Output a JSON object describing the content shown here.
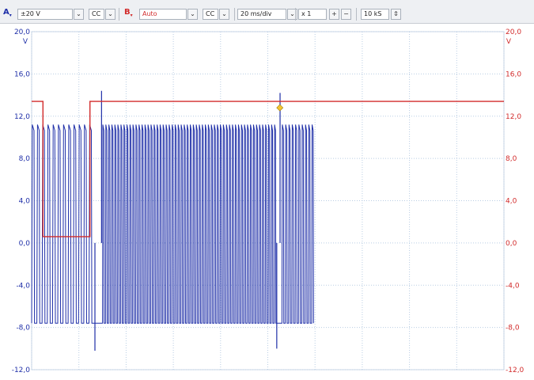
{
  "toolbar": {
    "channel_a": {
      "label": "A",
      "range": "±20 V",
      "coupling": "CC",
      "color": "#1f2fa8"
    },
    "channel_b": {
      "label": "B",
      "range": "Auto",
      "coupling": "CC",
      "color": "#d22b2b"
    },
    "timebase": "20 ms/div",
    "zoom": "x 1",
    "zoom_in_icon": "plus-icon",
    "zoom_out_icon": "minus-icon",
    "samples": "10 kS"
  },
  "chart_data": {
    "type": "line",
    "ylim": [
      -12,
      20
    ],
    "xlim": [
      0,
      200
    ],
    "x_unit": "ms",
    "yticks_left": [
      "20,0",
      "16,0",
      "12,0",
      "8,0",
      "4,0",
      "0,0",
      "-4,0",
      "-8,0",
      "-12,0"
    ],
    "yticks_right": [
      "20,0",
      "16,0",
      "12,0",
      "8,0",
      "4,0",
      "0,0",
      "-4,0",
      "-8,0",
      "-12,0"
    ],
    "ylabel_left": "V",
    "ylabel_right": "V",
    "grid": true,
    "series": [
      {
        "channel": "A",
        "color": "#1f2fa8",
        "kind": "oscillation",
        "high": 11.2,
        "low": -7.6,
        "segments": [
          {
            "x_start": 0,
            "x_end": 26.5,
            "pulses": 12
          },
          {
            "x_start": 30,
            "x_end": 104,
            "pulses": 58
          },
          {
            "x_start": 106,
            "x_end": 120,
            "pulses": 10
          }
        ],
        "spikes": [
          {
            "x": 29.6,
            "y": 14.4
          },
          {
            "x": 26.8,
            "y": -10.2
          },
          {
            "x": 103.8,
            "y": -10.0
          },
          {
            "x": 105.2,
            "y": 14.2
          }
        ]
      },
      {
        "channel": "B",
        "color": "#d22b2b",
        "kind": "step",
        "points": [
          [
            0,
            13.4
          ],
          [
            4.8,
            13.4
          ],
          [
            4.8,
            0.6
          ],
          [
            24.7,
            0.6
          ],
          [
            24.7,
            13.4
          ],
          [
            200,
            13.4
          ]
        ]
      }
    ],
    "marker": {
      "x": 105.1,
      "y": 12.8,
      "color": "#f4c430"
    }
  }
}
